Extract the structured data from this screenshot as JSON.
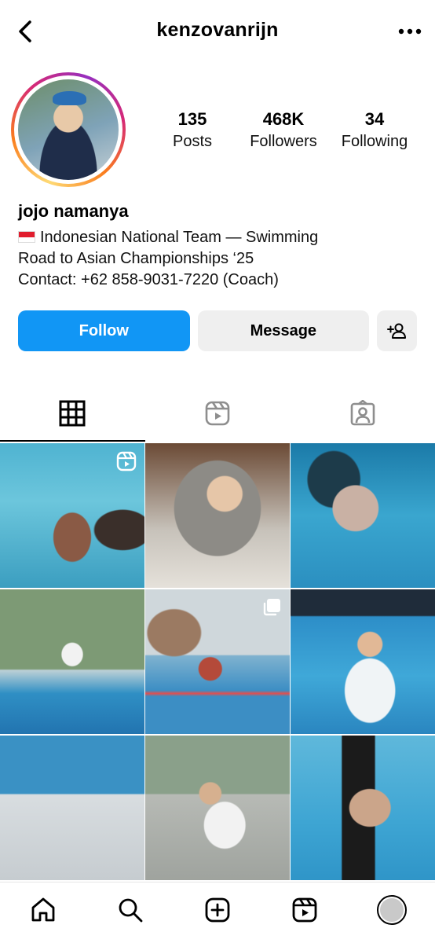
{
  "header": {
    "username": "kenzovanrijn",
    "back_icon": "chevron-left-icon",
    "more_icon": "more-horizontal-icon"
  },
  "profile": {
    "display_name": "jojo namanya",
    "bio": [
      "Indonesian National Team — Swimming",
      "Road to Asian Championships ‘25",
      "Contact: +62 858-9031-7220 (Coach)"
    ],
    "flag_icon": "indonesia-flag-icon",
    "story_ring_colors": [
      "#feda75",
      "#fa7e1e",
      "#d62976",
      "#962fbf"
    ]
  },
  "stats": {
    "posts_count": "135",
    "posts_label": "Posts",
    "followers_count": "468K",
    "followers_label": "Followers",
    "following_count": "34",
    "following_label": "Following"
  },
  "actions": {
    "follow_label": "Follow",
    "message_label": "Message",
    "follow_color": "#1196f5",
    "add_user_icon": "add-user-icon"
  },
  "tabs": [
    {
      "name": "posts",
      "icon": "grid-icon",
      "active": true
    },
    {
      "name": "reels",
      "icon": "reels-icon",
      "active": false
    },
    {
      "name": "tagged",
      "icon": "tagged-user-icon",
      "active": false
    }
  ],
  "grid": [
    {
      "badge": "reel-icon"
    },
    {
      "badge": ""
    },
    {
      "badge": ""
    },
    {
      "badge": ""
    },
    {
      "badge": "carousel-icon"
    },
    {
      "badge": ""
    },
    {
      "badge": ""
    },
    {
      "badge": ""
    },
    {
      "badge": ""
    }
  ],
  "bottom_nav": [
    {
      "icon": "home-icon"
    },
    {
      "icon": "search-icon"
    },
    {
      "icon": "create-post-icon"
    },
    {
      "icon": "reels-icon"
    },
    {
      "icon": "profile-avatar-icon"
    }
  ]
}
